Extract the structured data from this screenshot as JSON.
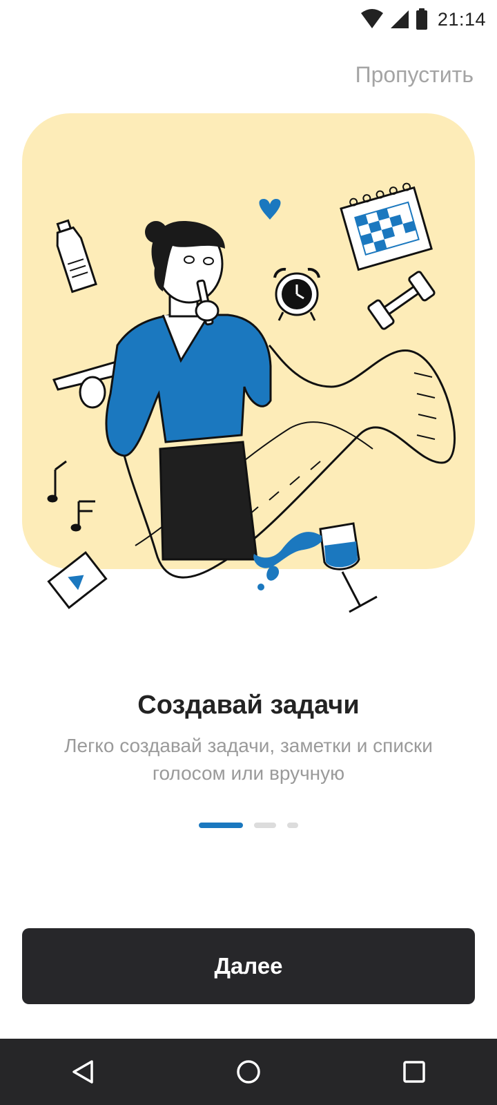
{
  "status_bar": {
    "time": "21:14",
    "icons": [
      "wifi-icon",
      "signal-icon",
      "battery-icon"
    ]
  },
  "header": {
    "skip_label": "Пропустить"
  },
  "illustration": {
    "icon": "woman-with-todo-list-illustration",
    "background_color": "#fdecb8",
    "accent_color": "#1b78bf"
  },
  "onboarding": {
    "title": "Создавай задачи",
    "subtitle": "Легко создавай задачи, заметки и списки голосом или вручную",
    "page_index": 1,
    "page_count": 3
  },
  "footer": {
    "next_label": "Далее"
  },
  "nav_bar": {
    "icons": [
      "back-icon",
      "home-icon",
      "recents-icon"
    ]
  }
}
